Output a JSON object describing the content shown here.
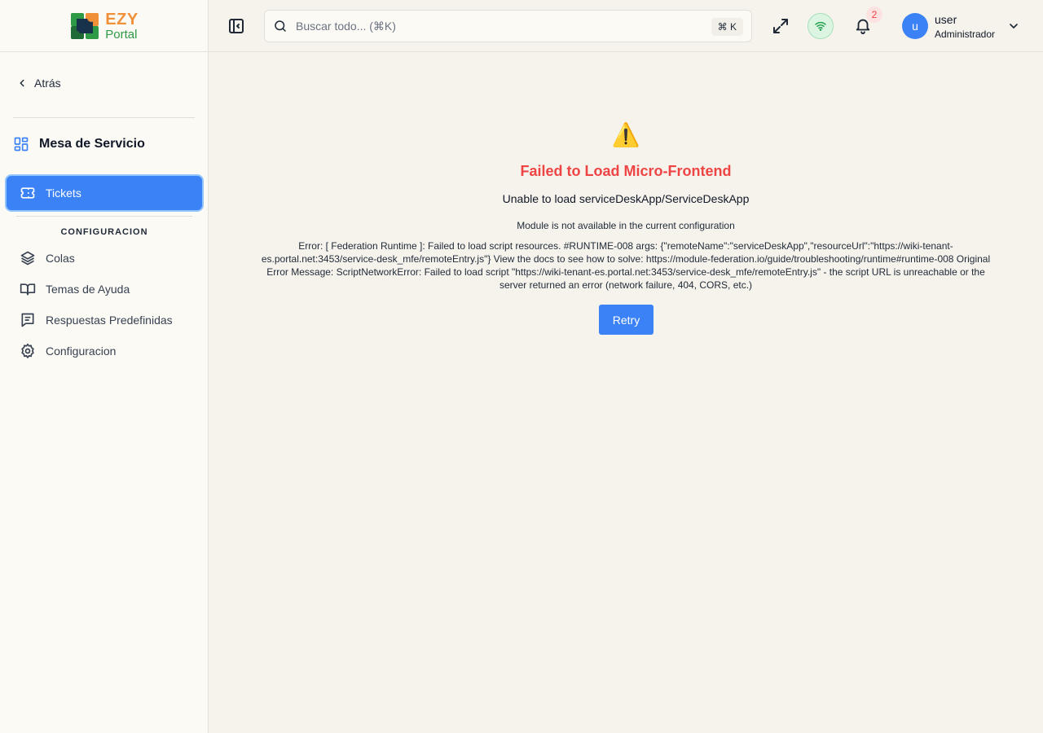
{
  "app": {
    "logo_line1": "EZY",
    "logo_line2": "Portal"
  },
  "sidebar": {
    "back_label": "Atrás",
    "section_title": "Mesa de Servicio",
    "active_item": "Tickets",
    "group_label": "CONFIGURACION",
    "items": [
      {
        "label": "Colas",
        "icon": "layers-icon"
      },
      {
        "label": "Temas de Ayuda",
        "icon": "book-icon"
      },
      {
        "label": "Respuestas Predefinidas",
        "icon": "message-lines-icon"
      },
      {
        "label": "Configuracion",
        "icon": "gear-icon"
      }
    ]
  },
  "header": {
    "search_placeholder": "Buscar todo... (⌘K)",
    "search_shortcut": "⌘ K",
    "notification_count": "2",
    "user_initial": "u",
    "user_name": "user",
    "user_role": "Administrador"
  },
  "error": {
    "icon": "⚠️",
    "title": "Failed to Load Micro-Frontend",
    "subtitle": "Unable to load serviceDeskApp/ServiceDeskApp",
    "message": "Module is not available in the current configuration",
    "detail": "Error: [ Federation Runtime ]: Failed to load script resources. #RUNTIME-008 args: {\"remoteName\":\"serviceDeskApp\",\"resourceUrl\":\"https://wiki-tenant-es.portal.net:3453/service-desk_mfe/remoteEntry.js\"} View the docs to see how to solve: https://module-federation.io/guide/troubleshooting/runtime#runtime-008 Original Error Message: ScriptNetworkError: Failed to load script \"https://wiki-tenant-es.portal.net:3453/service-desk_mfe/remoteEntry.js\" - the script URL is unreachable or the server returned an error (network failure, 404, CORS, etc.)",
    "retry_label": "Retry"
  },
  "colors": {
    "accent": "#3b82f6",
    "error": "#ef4444",
    "logo_orange": "#f0913a",
    "logo_green": "#2e9a45"
  }
}
